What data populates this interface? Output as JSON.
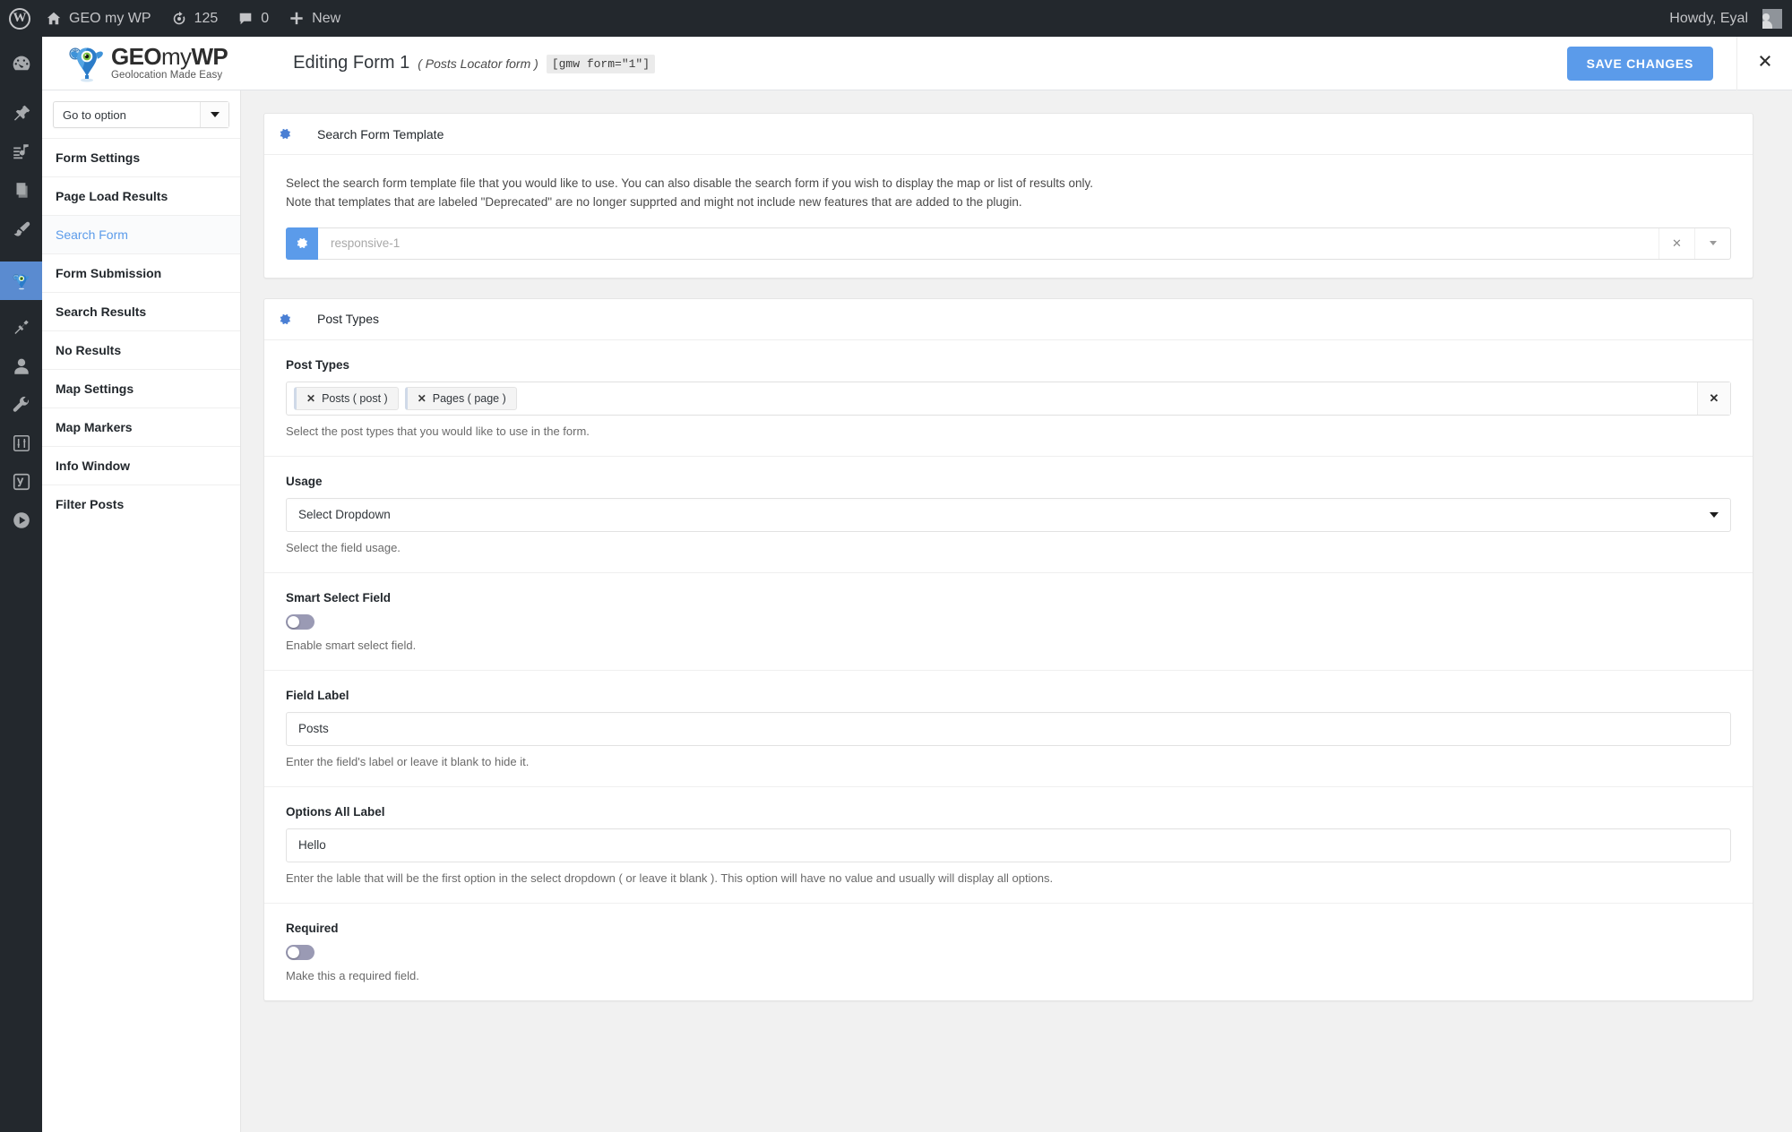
{
  "adminbar": {
    "wp_logo": "wordpress-logo",
    "site_name": "GEO my WP",
    "updates_count": "125",
    "comments_count": "0",
    "new_label": "New",
    "howdy": "Howdy, Eyal"
  },
  "adminmenu": {
    "items": [
      {
        "icon": "dashboard-icon",
        "name": "dashboard"
      },
      {
        "icon": "pin-icon",
        "name": "posts"
      },
      {
        "icon": "media-icon",
        "name": "media"
      },
      {
        "icon": "pages-icon",
        "name": "pages"
      },
      {
        "icon": "brush-icon",
        "name": "appearance"
      },
      {
        "icon": "gmw-mascot-icon",
        "name": "geo-my-wp",
        "current": true
      },
      {
        "icon": "plug-icon",
        "name": "plugins"
      },
      {
        "icon": "user-icon",
        "name": "users"
      },
      {
        "icon": "wrench-icon",
        "name": "tools"
      },
      {
        "icon": "sliders-icon",
        "name": "settings"
      },
      {
        "icon": "yoast-icon",
        "name": "yoast-seo"
      },
      {
        "icon": "play-icon",
        "name": "media-player"
      }
    ]
  },
  "header": {
    "brand_name_geo": "GEO",
    "brand_name_my": "my",
    "brand_name_wp": "WP",
    "brand_tagline": "Geolocation Made Easy",
    "title": "Editing Form 1",
    "subtitle": "( Posts Locator form )",
    "shortcode": "[gmw form=\"1\"]",
    "save_label": "SAVE CHANGES",
    "close_icon": "close-icon",
    "accent_color": "#5b9bea"
  },
  "nav": {
    "goto_label": "Go to option",
    "items": [
      {
        "label": "Form Settings",
        "active": false
      },
      {
        "label": "Page Load Results",
        "active": false
      },
      {
        "label": "Search Form",
        "active": true
      },
      {
        "label": "Form Submission",
        "active": false
      },
      {
        "label": "Search Results",
        "active": false
      },
      {
        "label": "No Results",
        "active": false
      },
      {
        "label": "Map Settings",
        "active": false
      },
      {
        "label": "Map Markers",
        "active": false
      },
      {
        "label": "Info Window",
        "active": false
      },
      {
        "label": "Filter Posts",
        "active": false
      }
    ]
  },
  "panels": {
    "search_form_template": {
      "title": "Search Form Template",
      "desc_line1": "Select the search form template file that you would like to use. You can also disable the search form if you wish to display the map or list of results only.",
      "desc_line2": "Note that templates that are labeled \"Deprecated\" are no longer supprted and might not include new features that are added to the plugin.",
      "template_value": "responsive-1",
      "clear_icon": "x-icon",
      "dropdown_icon": "chevron-down-icon"
    },
    "post_types": {
      "title": "Post Types",
      "fields": {
        "post_types": {
          "label": "Post Types",
          "tags": [
            {
              "label": "Posts ( post )"
            },
            {
              "label": "Pages ( page )"
            }
          ],
          "clear_all_icon": "x-icon",
          "desc": "Select the post types that you would like to use in the form."
        },
        "usage": {
          "label": "Usage",
          "value": "Select Dropdown",
          "desc": "Select the field usage."
        },
        "smart_select": {
          "label": "Smart Select Field",
          "enabled": false,
          "desc": "Enable smart select field."
        },
        "field_label": {
          "label": "Field Label",
          "value": "Posts",
          "desc": "Enter the field's label or leave it blank to hide it."
        },
        "options_all_label": {
          "label": "Options All Label",
          "value": "Hello",
          "desc": "Enter the lable that will be the first option in the select dropdown ( or leave it blank ). This option will have no value and usually will display all options."
        },
        "required": {
          "label": "Required",
          "enabled": false,
          "desc": "Make this a required field."
        }
      }
    }
  }
}
